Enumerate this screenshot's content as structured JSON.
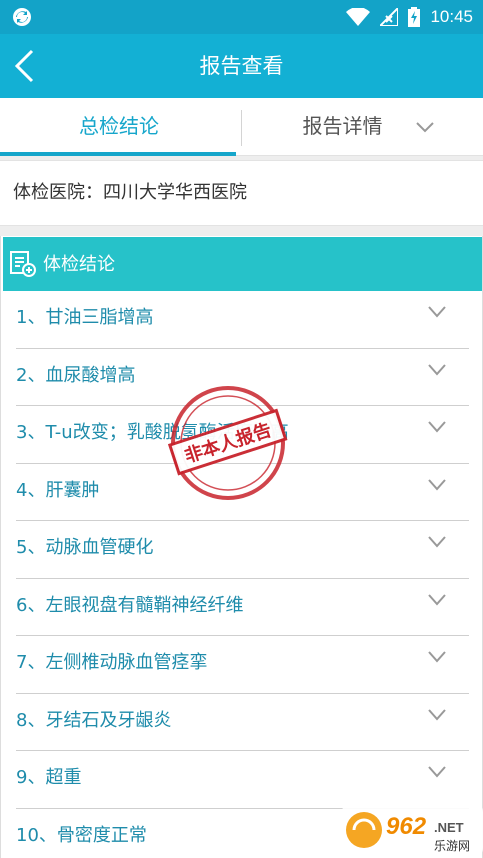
{
  "statusbar": {
    "time": "10:45",
    "icons": [
      "sync-icon",
      "wifi-icon",
      "signal-off-icon",
      "battery-charging-icon"
    ]
  },
  "navbar": {
    "title": "报告查看",
    "back_icon": "chevron-left-icon"
  },
  "tabs": [
    {
      "label": "总检结论",
      "active": true
    },
    {
      "label": "报告详情",
      "active": false,
      "icon": "chevron-down-icon"
    }
  ],
  "hospital": {
    "text": "体检医院：四川大学华西医院"
  },
  "conclusion": {
    "header": "体检结论",
    "header_icon": "report-add-icon",
    "items": [
      "1、甘油三脂增高",
      "2、血尿酸增高",
      "3、T-u改变；乳酸脱氢酶活度增高",
      "4、肝囊肿",
      "5、动脉血管硬化",
      "6、左眼视盘有髓鞘神经纤维",
      "7、左侧椎动脉血管痉挛",
      "8、牙结石及牙龈炎",
      "9、超重",
      "10、骨密度正常"
    ]
  },
  "stamp": {
    "text": "非本人报告"
  },
  "watermark": {
    "brand": "962",
    "suffix": ".NET",
    "subtitle": "乐游网"
  },
  "colors": {
    "statusbar": "#13a3c8",
    "navbar": "#13b0d4",
    "accent": "#16a6cb",
    "card_header": "#26c2c9",
    "item_text": "#1f8cab",
    "stamp": "#c8232c"
  }
}
